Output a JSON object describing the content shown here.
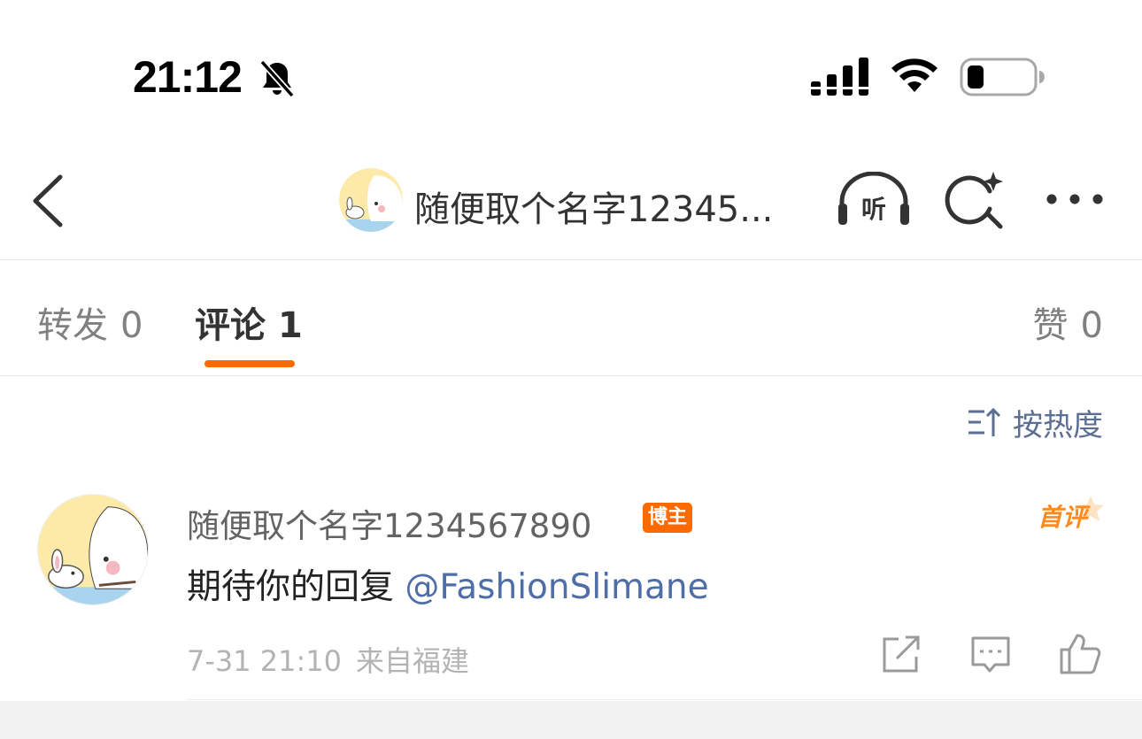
{
  "status_bar": {
    "time": "21:12",
    "icons": [
      "bell-slash-icon",
      "cellular-signal-icon",
      "wifi-icon",
      "battery-icon"
    ],
    "battery_level": 0.18
  },
  "nav": {
    "title": "随便取个名字12345...",
    "listen_label": "听",
    "icons": [
      "back-icon",
      "avatar",
      "listen-icon",
      "ai-search-icon",
      "more-icon"
    ]
  },
  "tabs": [
    {
      "label": "转发",
      "count": "0",
      "active": false
    },
    {
      "label": "评论",
      "count": "1",
      "active": true
    },
    {
      "label": "赞",
      "count": "0",
      "active": false
    }
  ],
  "sort": {
    "label": "按热度",
    "icon": "sort-icon"
  },
  "comment": {
    "username": "随便取个名字1234567890",
    "badge": "博主",
    "first_badge": "首评",
    "text": "期待你的回复 ",
    "mention": "@FashionSlimane",
    "time": "7-31 21:10",
    "location": "来自福建",
    "actions": [
      "repost-icon",
      "reply-icon",
      "like-icon"
    ]
  },
  "colors": {
    "accent": "#ff6a00",
    "link": "#4f6ea8",
    "sort": "#5b6e93",
    "muted": "#b3b3b3"
  }
}
